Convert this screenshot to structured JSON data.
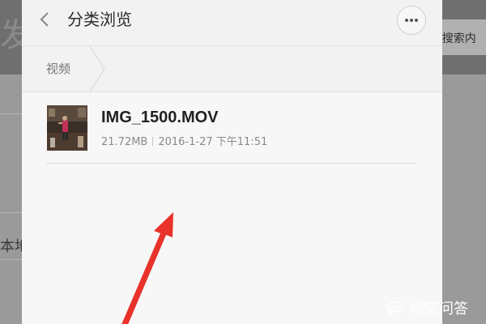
{
  "background": {
    "logo_text": "发",
    "search_text": "\\搜索内",
    "side_text": "本地"
  },
  "header": {
    "back_icon": "chevron-left-icon",
    "title": "分类浏览",
    "more_icon": "more-horizontal-icon"
  },
  "breadcrumb": {
    "label": "视频"
  },
  "files": [
    {
      "name": "IMG_1500.MOV",
      "size": "21.72MB",
      "date": "2016-1-27 下午11:51",
      "thumbnail": "video-thumbnail"
    }
  ],
  "annotation": {
    "type": "red-arrow",
    "color": "#e8322a"
  },
  "watermark": {
    "icon": "chat-bubble-icon",
    "text": "悟空问答"
  },
  "colors": {
    "modal_bg": "#f7f7f7",
    "header_bg": "#f2f2f2",
    "overlay": "#8d8d8d",
    "arrow": "#e8322a"
  }
}
